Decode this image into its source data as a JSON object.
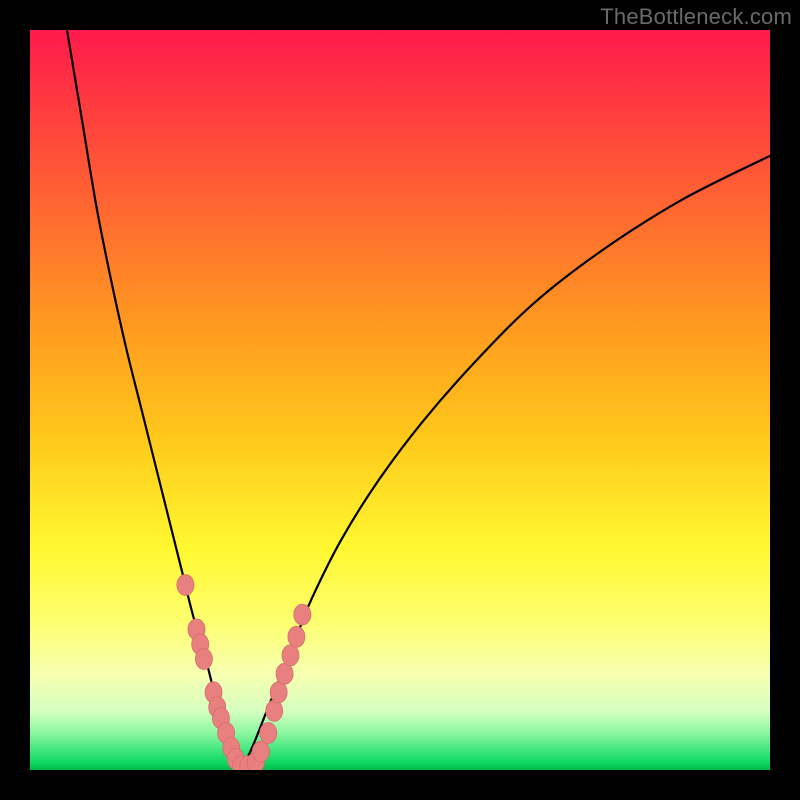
{
  "watermark": {
    "text": "TheBottleneck.com"
  },
  "colors": {
    "frame": "#000000",
    "curve": "#000000",
    "dot_fill": "#e98080",
    "dot_stroke": "#d76b6b",
    "gradient_stops": [
      "#ff1a4d",
      "#ff3a3f",
      "#ff6a30",
      "#ff9a20",
      "#ffc81a",
      "#fff830",
      "#fdff70",
      "#f7ffb0",
      "#d6ffc0",
      "#8cf7a0",
      "#3be47a",
      "#0fd861",
      "#00b84c"
    ]
  },
  "chart_data": {
    "type": "line",
    "title": "",
    "xlabel": "",
    "ylabel": "",
    "xlim": [
      0,
      100
    ],
    "ylim": [
      0,
      100
    ],
    "grid": false,
    "legend": false,
    "series": [
      {
        "name": "left-branch",
        "x": [
          5,
          7,
          9,
          11,
          13,
          15,
          17,
          19,
          20.5,
          22,
          24,
          25.5,
          27,
          28.5
        ],
        "y": [
          100,
          88,
          76,
          66,
          57,
          49,
          41,
          33,
          27,
          21,
          14,
          8,
          3,
          0
        ]
      },
      {
        "name": "right-branch",
        "x": [
          28.5,
          30,
          32,
          34,
          36,
          38,
          42,
          47,
          53,
          60,
          68,
          77,
          88,
          100
        ],
        "y": [
          0,
          3,
          8,
          13,
          18,
          23,
          31,
          39,
          47,
          55,
          63,
          70,
          77,
          83
        ]
      }
    ],
    "scatter_points": {
      "name": "highlight-dots",
      "x": [
        21.0,
        22.5,
        23.0,
        23.5,
        24.8,
        25.3,
        25.8,
        26.5,
        27.2,
        27.8,
        28.5,
        29.5,
        30.5,
        31.2,
        32.2,
        33.0,
        33.6,
        34.4,
        35.2,
        36.0,
        36.8
      ],
      "y": [
        25.0,
        19.0,
        17.0,
        15.0,
        10.5,
        8.5,
        7.0,
        5.0,
        3.0,
        1.5,
        0.5,
        0.5,
        1.0,
        2.5,
        5.0,
        8.0,
        10.5,
        13.0,
        15.5,
        18.0,
        21.0
      ]
    },
    "notch_x": 28.5
  }
}
